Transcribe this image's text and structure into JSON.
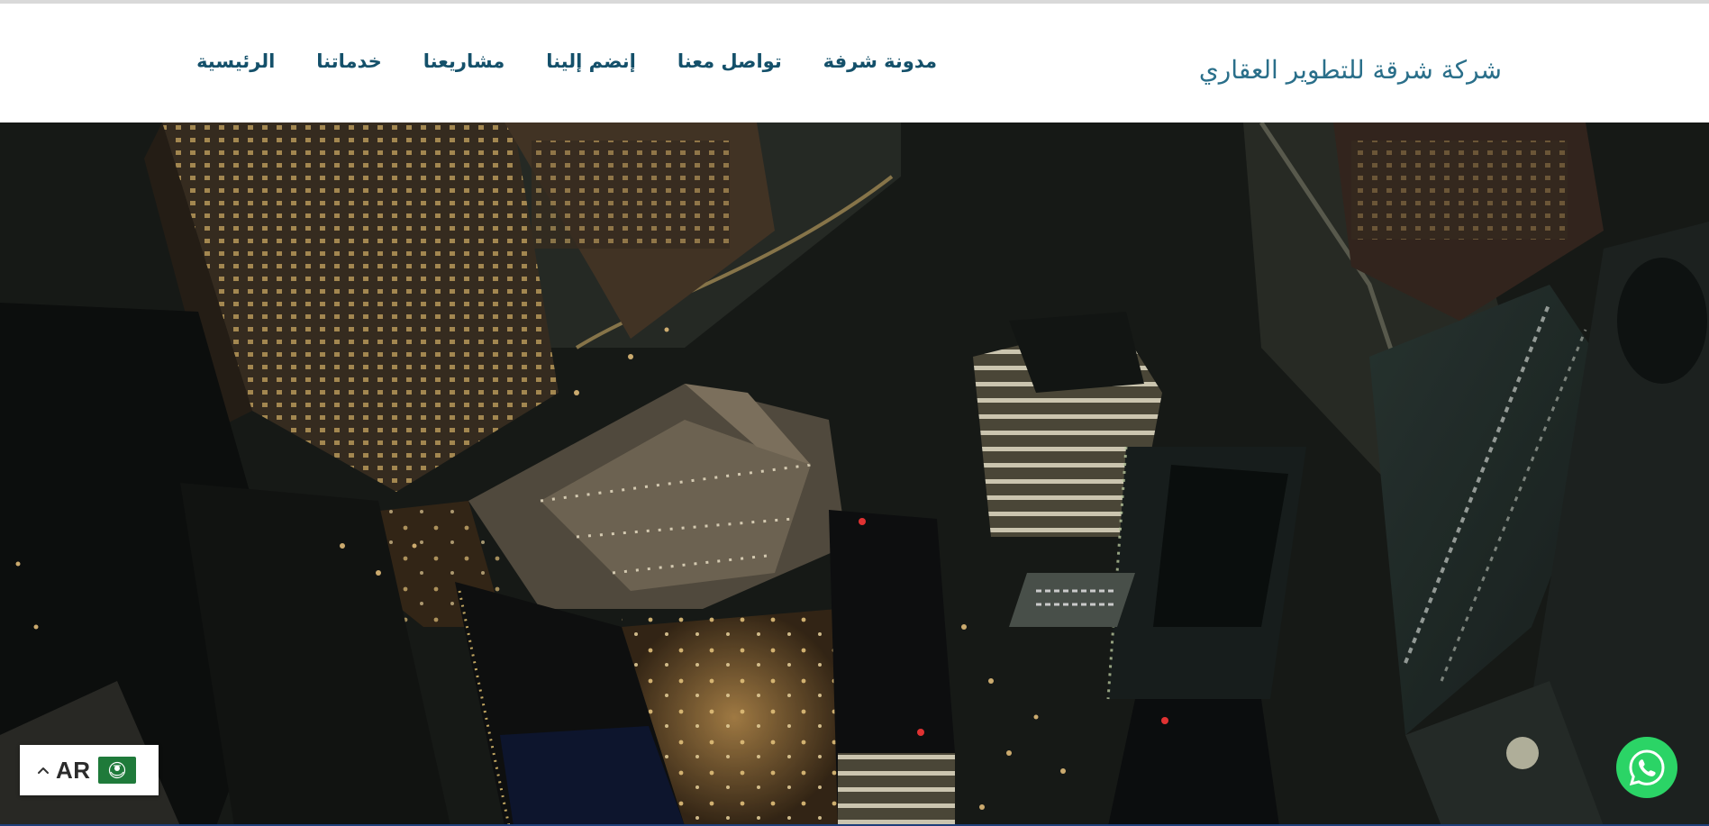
{
  "header": {
    "logo": {
      "text": "شركة شرقة للتطوير العقاري",
      "icon": "company-logo-mark"
    },
    "nav": [
      {
        "label": "الرئيسية"
      },
      {
        "label": "خدماتنا"
      },
      {
        "label": "مشاريعنا"
      },
      {
        "label": "إنضم إلينا"
      },
      {
        "label": "تواصل معنا"
      },
      {
        "label": "مدونة شرفة"
      }
    ],
    "brand_color": "#14506a"
  },
  "hero": {
    "image": "aerial-night-city-skyline",
    "theme": "dark"
  },
  "language_switcher": {
    "code": "AR",
    "icon": "chevron-up-icon",
    "flag_icon": "arab-league-flag-icon",
    "flag_color": "#1f7a3a"
  },
  "whatsapp": {
    "icon": "whatsapp-icon",
    "color": "#2bd466"
  }
}
